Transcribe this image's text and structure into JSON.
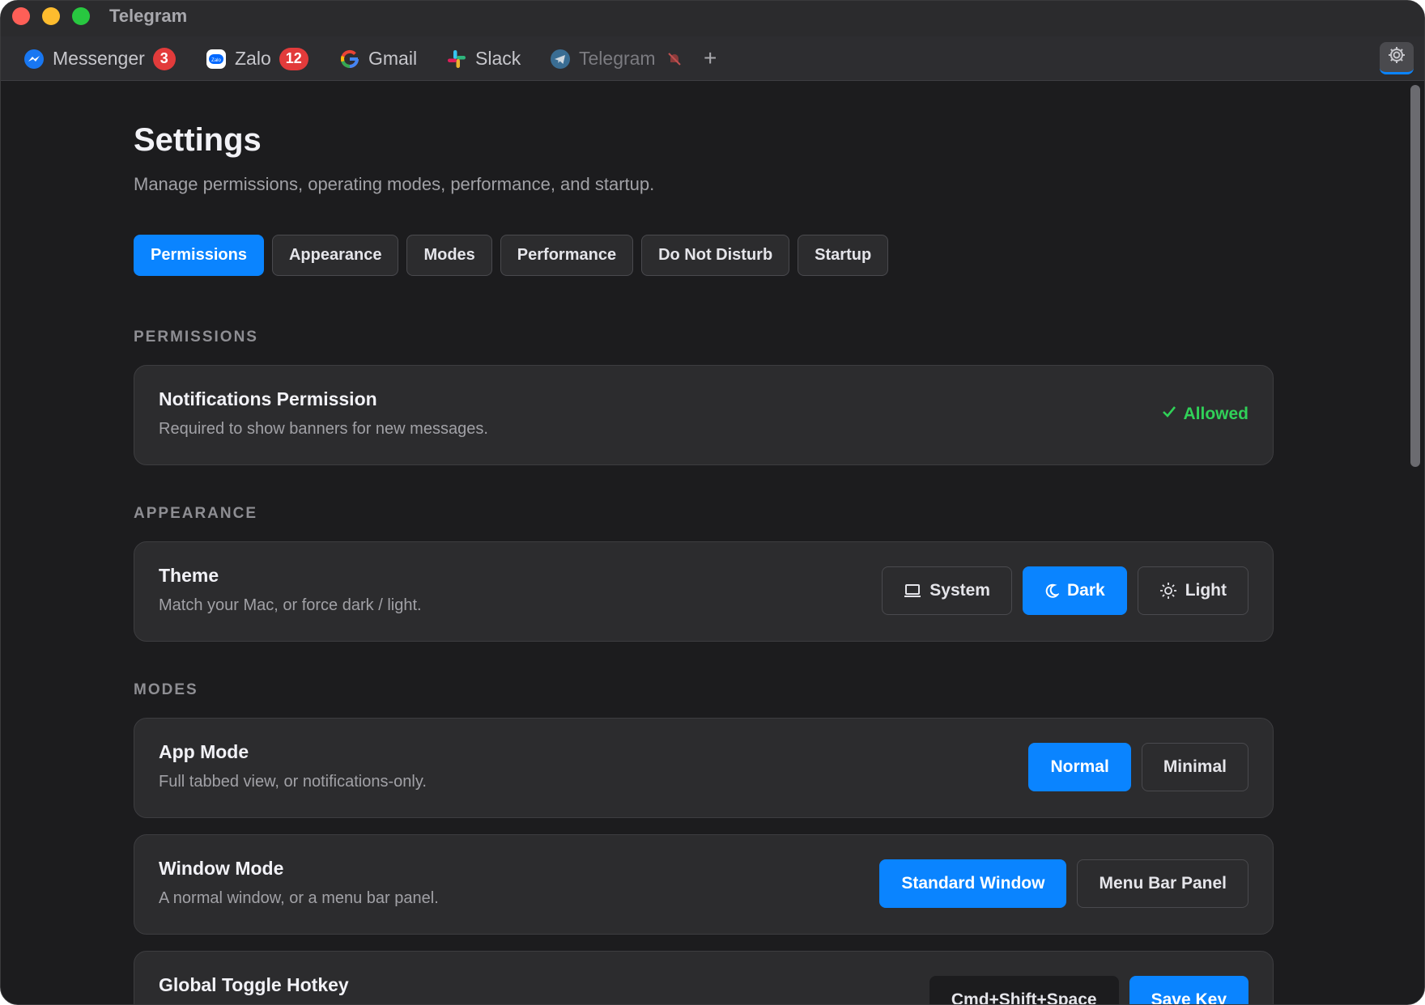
{
  "window": {
    "title": "Telegram"
  },
  "service_tabs": [
    {
      "label": "Messenger",
      "badge": "3",
      "icon": "messenger-icon"
    },
    {
      "label": "Zalo",
      "badge": "12",
      "icon": "zalo-icon"
    },
    {
      "label": "Gmail",
      "badge": "",
      "icon": "gmail-icon"
    },
    {
      "label": "Slack",
      "badge": "",
      "icon": "slack-icon"
    },
    {
      "label": "Telegram",
      "badge": "",
      "icon": "telegram-icon",
      "muted": true
    }
  ],
  "tabstrip": {
    "add_label": "+",
    "settings_icon": "gear-icon"
  },
  "settings": {
    "title": "Settings",
    "subtitle": "Manage permissions, operating modes, performance, and startup.",
    "tabs": [
      "Permissions",
      "Appearance",
      "Modes",
      "Performance",
      "Do Not Disturb",
      "Startup"
    ],
    "active_tab": "Permissions"
  },
  "sections": {
    "permissions": {
      "label": "PERMISSIONS",
      "notifications": {
        "title": "Notifications Permission",
        "description": "Required to show banners for new messages.",
        "status": "Allowed"
      }
    },
    "appearance": {
      "label": "APPEARANCE",
      "theme": {
        "title": "Theme",
        "description": "Match your Mac, or force dark / light.",
        "options": [
          "System",
          "Dark",
          "Light"
        ],
        "selected": "Dark"
      }
    },
    "modes": {
      "label": "MODES",
      "app_mode": {
        "title": "App Mode",
        "description": "Full tabbed view, or notifications-only.",
        "options": [
          "Normal",
          "Minimal"
        ],
        "selected": "Normal"
      },
      "window_mode": {
        "title": "Window Mode",
        "description": "A normal window, or a menu bar panel.",
        "options": [
          "Standard Window",
          "Menu Bar Panel"
        ],
        "selected": "Standard Window"
      },
      "hotkey": {
        "title": "Global Toggle Hotkey",
        "value": "Cmd+Shift+Space",
        "save_label": "Save Key"
      }
    }
  },
  "colors": {
    "accent": "#0a84ff",
    "background": "#1c1c1e",
    "card": "#2c2c2e",
    "success": "#30d158",
    "badge": "#e23b3b"
  }
}
